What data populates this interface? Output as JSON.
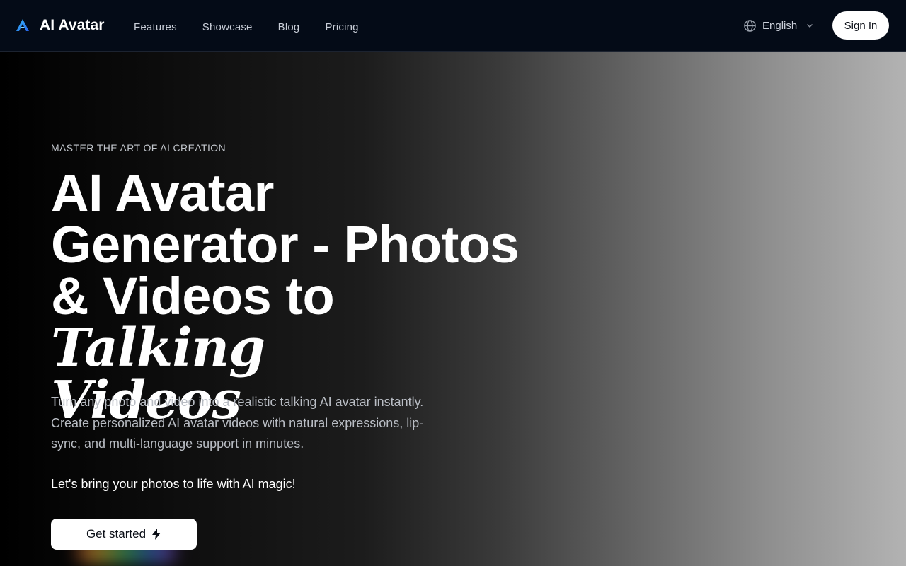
{
  "brand": {
    "name": "AI Avatar",
    "logo_icon": "a-logo-icon"
  },
  "nav": {
    "items": [
      "Features",
      "Showcase",
      "Blog",
      "Pricing"
    ]
  },
  "header": {
    "language": "English",
    "signin_label": "Sign In"
  },
  "hero": {
    "eyebrow": "MASTER THE ART OF AI CREATION",
    "headline_line1": "AI Avatar",
    "headline_line2": "Generator - Photos",
    "headline_line3_plain": "& Videos to ",
    "headline_line3_italic": "Talking",
    "headline_line4_italic": "Videos",
    "subtitle": "Turn any photo and video into a realistic talking AI avatar instantly. Create personalized AI avatar videos with natural expressions, lip-sync, and multi-language support in minutes.",
    "tagline": "Let's bring your photos to life with AI magic!",
    "cta_label": "Get started"
  },
  "colors": {
    "topbar_bg": "#040b17",
    "logo_gradient": [
      "#38bdf8",
      "#2563eb"
    ],
    "cta_bg": "#ffffff"
  }
}
